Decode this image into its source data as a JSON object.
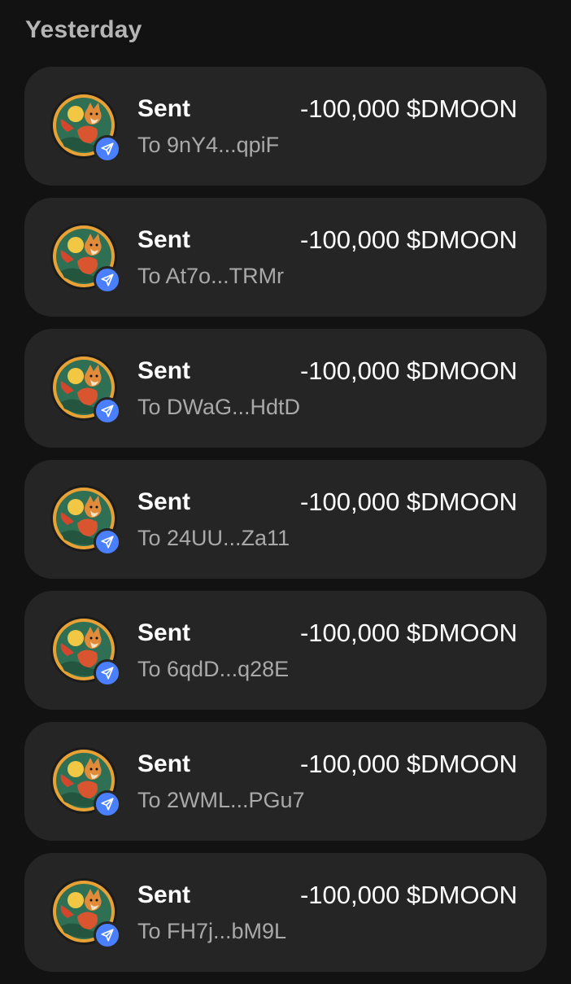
{
  "section": {
    "title": "Yesterday"
  },
  "colors": {
    "background": "#121212",
    "card": "#252525",
    "badge": "#4a80ff",
    "secondary_text": "#a9a9a9"
  },
  "transactions": [
    {
      "type": "Sent",
      "amount": "-100,000 $DMOON",
      "recipient": "To 9nY4...qpiF",
      "token_icon": "dmoon-token-icon",
      "badge_icon": "send-icon"
    },
    {
      "type": "Sent",
      "amount": "-100,000 $DMOON",
      "recipient": "To At7o...TRMr",
      "token_icon": "dmoon-token-icon",
      "badge_icon": "send-icon"
    },
    {
      "type": "Sent",
      "amount": "-100,000 $DMOON",
      "recipient": "To DWaG...HdtD",
      "token_icon": "dmoon-token-icon",
      "badge_icon": "send-icon"
    },
    {
      "type": "Sent",
      "amount": "-100,000 $DMOON",
      "recipient": "To 24UU...Za11",
      "token_icon": "dmoon-token-icon",
      "badge_icon": "send-icon"
    },
    {
      "type": "Sent",
      "amount": "-100,000 $DMOON",
      "recipient": "To 6qdD...q28E",
      "token_icon": "dmoon-token-icon",
      "badge_icon": "send-icon"
    },
    {
      "type": "Sent",
      "amount": "-100,000 $DMOON",
      "recipient": "To 2WML...PGu7",
      "token_icon": "dmoon-token-icon",
      "badge_icon": "send-icon"
    },
    {
      "type": "Sent",
      "amount": "-100,000 $DMOON",
      "recipient": "To FH7j...bM9L",
      "token_icon": "dmoon-token-icon",
      "badge_icon": "send-icon"
    }
  ]
}
